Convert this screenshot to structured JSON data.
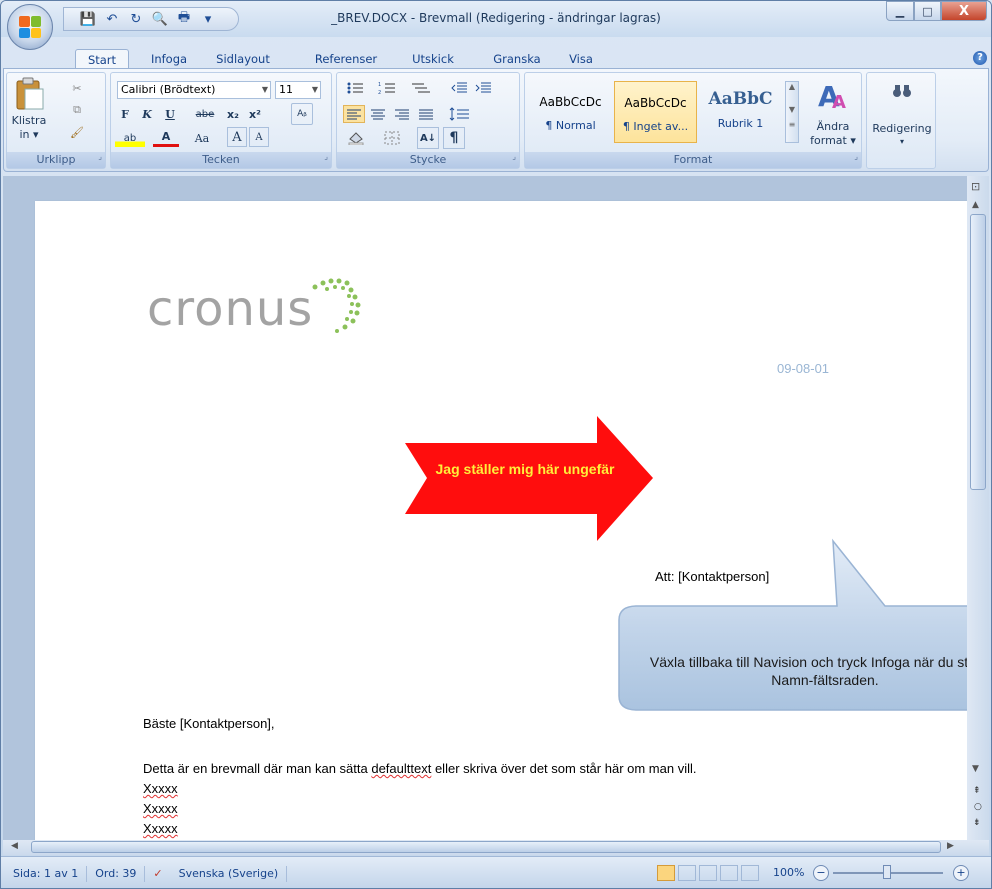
{
  "window": {
    "title": "_BREV.DOCX - Brevmall (Redigering - ändringar lagras)",
    "minimize": "▁",
    "maximize": "□",
    "close": "X"
  },
  "qat": {
    "save": "💾",
    "undo": "↶",
    "redo": "↻",
    "print_preview": "🔍",
    "print": "🖶",
    "customize": "▾"
  },
  "tabs": [
    "Start",
    "Infoga",
    "Sidlayout",
    "Referenser",
    "Utskick",
    "Granska",
    "Visa"
  ],
  "help": "?",
  "ribbon": {
    "clipboard": {
      "paste_label": "Klistra",
      "paste_sub": "in ▾",
      "cut": "✂",
      "copy": "⧉",
      "format_painter": "🖌",
      "group_label": "Urklipp"
    },
    "font": {
      "font_name": "Calibri (Brödtext)",
      "font_size": "11",
      "bold": "F",
      "italic": "K",
      "underline": "U",
      "strike": "abe",
      "subscript": "x₂",
      "superscript": "x²",
      "clear": "Aᵦ",
      "highlight": "ab",
      "color": "A",
      "case": "Aa",
      "grow": "A",
      "shrink": "A",
      "group_label": "Tecken"
    },
    "paragraph": {
      "group_label": "Stycke",
      "show_marks": "¶",
      "sort": "A↓"
    },
    "styles": {
      "items": [
        {
          "preview": "AaBbCcDc",
          "name": "¶ Normal"
        },
        {
          "preview": "AaBbCcDc",
          "name": "¶ Inget av..."
        },
        {
          "preview": "AaBbC",
          "name": "Rubrik 1"
        }
      ],
      "change_label": "Ändra",
      "change_sub": "format ▾",
      "group_label": "Format"
    },
    "editing": {
      "label": "Redigering",
      "sub": "▾"
    }
  },
  "document": {
    "logo": "cronus",
    "date": "09-08-01",
    "arrow_text": "Jag ställer mig här ungefär",
    "att": "Att: [Kontaktperson]",
    "callout": "Växla tillbaka till Navision och tryck Infoga när du står på Namn-fältsraden.",
    "greeting": "Bäste [Kontaktperson],",
    "body_before": "Detta är en brevmall där man kan sätta ",
    "body_link": "defaulttext",
    "body_after": " eller skriva över det som står här om man vill.",
    "lines": [
      "Xxxxx",
      "Xxxxx",
      "Xxxxx"
    ]
  },
  "status": {
    "page": "Sida: 1 av 1",
    "words": "Ord: 39",
    "language": "Svenska (Sverige)",
    "zoom": "100%",
    "zoom_out": "−",
    "zoom_in": "+"
  },
  "colors": {
    "arrow": "#ff0d0d",
    "arrow_text": "#ffef3a",
    "callout_fill": "#c8d8ea"
  }
}
